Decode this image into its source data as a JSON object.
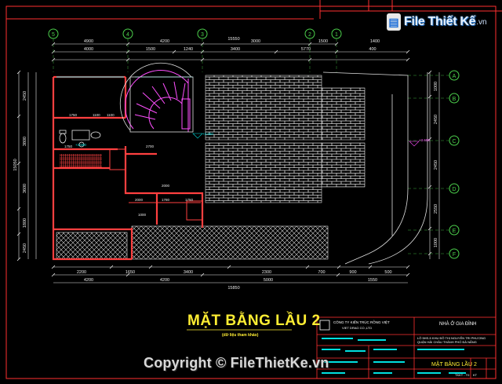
{
  "drawing": {
    "title": "MẶT BẰNG LẦU 2",
    "subtitle": "(dữ liệu tham khảo)"
  },
  "logo": {
    "text": "File Thiết Kế",
    "suffix": ".vn"
  },
  "watermark": {
    "text": "Copyright © FileThietKe.vn"
  },
  "grid_top": [
    "5",
    "4",
    "3",
    "2",
    "1"
  ],
  "grid_right": [
    "A",
    "B",
    "C",
    "D",
    "E",
    "F"
  ],
  "dims_top_row1": [
    "4900",
    "4200",
    "3000",
    "1500",
    "1400"
  ],
  "dims_top_row2": [
    "4000",
    "1500",
    "1240",
    "3400",
    "5770",
    "400"
  ],
  "dims_total_top": "15550",
  "dims_bottom_row1": [
    "2200",
    "1650",
    "3400",
    "2300",
    "700",
    "900",
    "500"
  ],
  "dims_bottom_row2": [
    "4200",
    "4200",
    "5000",
    "1550"
  ],
  "dims_total_bottom": "15850",
  "dims_left": [
    "2450",
    "3800",
    "3600",
    "1800",
    "2450"
  ],
  "dims_left_total": "15050",
  "dims_right": [
    "1000",
    "2450",
    "2450",
    "2550",
    "1000"
  ],
  "title_block": {
    "company": "CÔNG TY KIẾN TRÚC RỒNG VIỆT",
    "company_en": "VIET DRAG CO.,LTD",
    "project": "NHÀ Ở GIA ĐÌNH",
    "address_line1": "LÔ 5HS-5 KHU ĐÔ THỊ NGUYỄN TRI PHƯƠNG",
    "address_line2": "QUẬN HẢI CHÂU THÀNH PHỐ ĐÀ NẴNG",
    "sheet_title": "MẶT BẰNG LẦU 2",
    "sheet_code": "TKKT - T0",
    "sheet_no": "KT"
  },
  "colors": {
    "background": "#000000",
    "border": "#ff3030",
    "wall": "#ff4040",
    "dimension": "#e8e8e8",
    "grid_bubble": "#4cd04c",
    "stair": "#ff4fff",
    "hatch": "#ffffff",
    "cyan_text": "#00e0e0",
    "title_yellow": "#ffee33"
  }
}
